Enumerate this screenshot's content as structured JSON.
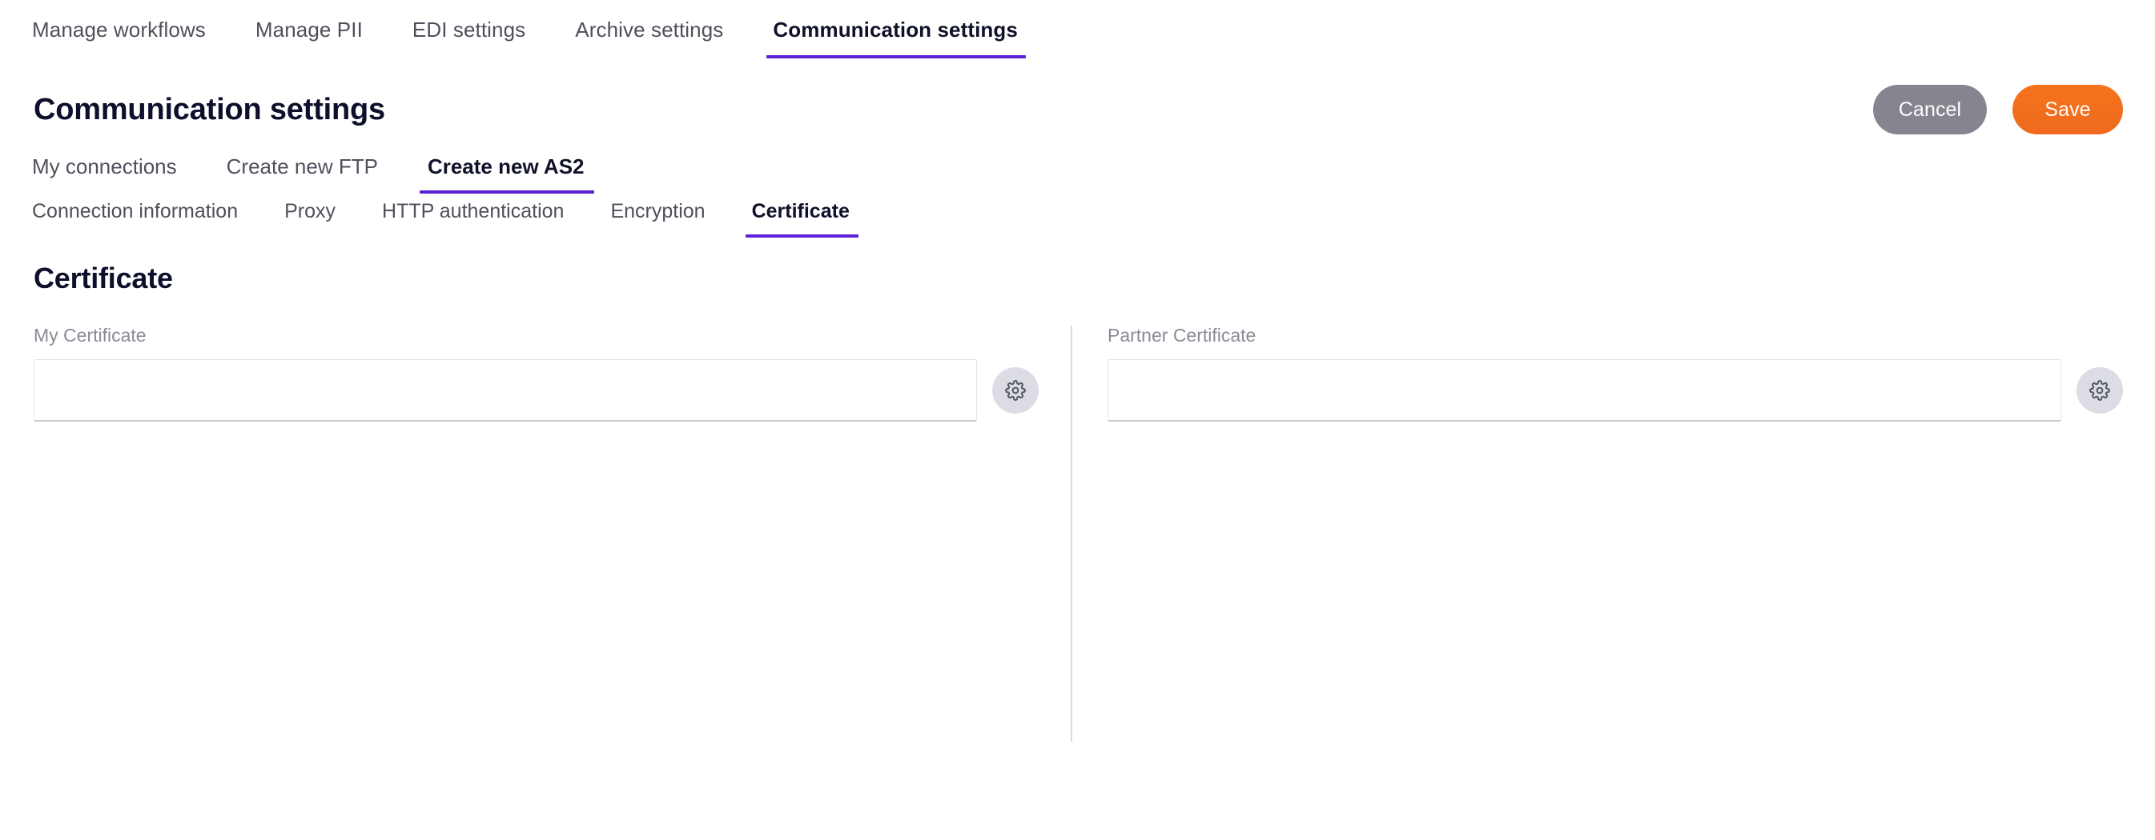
{
  "top_tabs": [
    {
      "label": "Manage workflows",
      "active": false
    },
    {
      "label": "Manage PII",
      "active": false
    },
    {
      "label": "EDI settings",
      "active": false
    },
    {
      "label": "Archive settings",
      "active": false
    },
    {
      "label": "Communication settings",
      "active": true
    }
  ],
  "header": {
    "title": "Communication settings",
    "cancel_label": "Cancel",
    "save_label": "Save"
  },
  "sub_tabs": [
    {
      "label": "My connections",
      "active": false
    },
    {
      "label": "Create new FTP",
      "active": false
    },
    {
      "label": "Create new AS2",
      "active": true
    }
  ],
  "inner_tabs": [
    {
      "label": "Connection information",
      "active": false
    },
    {
      "label": "Proxy",
      "active": false
    },
    {
      "label": "HTTP authentication",
      "active": false
    },
    {
      "label": "Encryption",
      "active": false
    },
    {
      "label": "Certificate",
      "active": true
    }
  ],
  "section": {
    "title": "Certificate"
  },
  "fields": {
    "my_certificate": {
      "label": "My Certificate",
      "value": "",
      "placeholder": "",
      "settings_icon": "gear-icon"
    },
    "partner_certificate": {
      "label": "Partner Certificate",
      "value": "",
      "placeholder": "",
      "settings_icon": "gear-icon"
    }
  },
  "colors": {
    "accent_purple": "#5b21d6",
    "save_orange": "#f3711b",
    "cancel_gray": "#85858f",
    "title_navy": "#0d0f2b",
    "label_gray": "#898b97"
  }
}
